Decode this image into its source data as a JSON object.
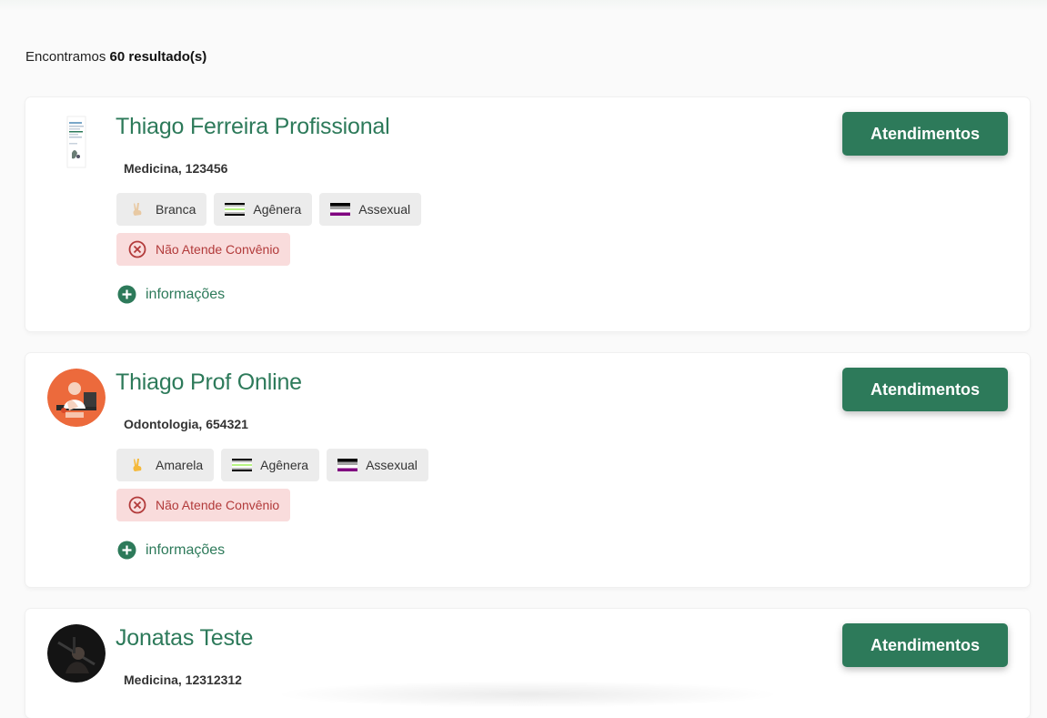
{
  "results": {
    "prefix": "Encontramos",
    "count": "60 resultado(s)"
  },
  "action_button_label": "Atendimentos",
  "info_label": "informações",
  "colors": {
    "primary": "#2d7a5a",
    "chip_bg": "#ececec",
    "warning_bg": "#f9dcdc",
    "warning_text": "#b23a3a"
  },
  "professionals": [
    {
      "name": "Thiago Ferreira Profissional",
      "registration": "Medicina, 123456",
      "avatar": "document-thumbnail",
      "tags": [
        {
          "icon": "peace-hand-icon",
          "label": "Branca"
        },
        {
          "icon": "agender-flag-icon",
          "label": "Agênera"
        },
        {
          "icon": "asexual-flag-icon",
          "label": "Assexual"
        }
      ],
      "insurance": "Não Atende Convênio"
    },
    {
      "name": "Thiago Prof Online",
      "registration": "Odontologia, 654321",
      "avatar": "illustration-orange",
      "tags": [
        {
          "icon": "peace-hand-icon",
          "label": "Amarela"
        },
        {
          "icon": "agender-flag-icon",
          "label": "Agênera"
        },
        {
          "icon": "asexual-flag-icon",
          "label": "Assexual"
        }
      ],
      "insurance": "Não Atende Convênio"
    },
    {
      "name": "Jonatas Teste",
      "registration": "Medicina, 12312312",
      "avatar": "photo-dark"
    }
  ]
}
